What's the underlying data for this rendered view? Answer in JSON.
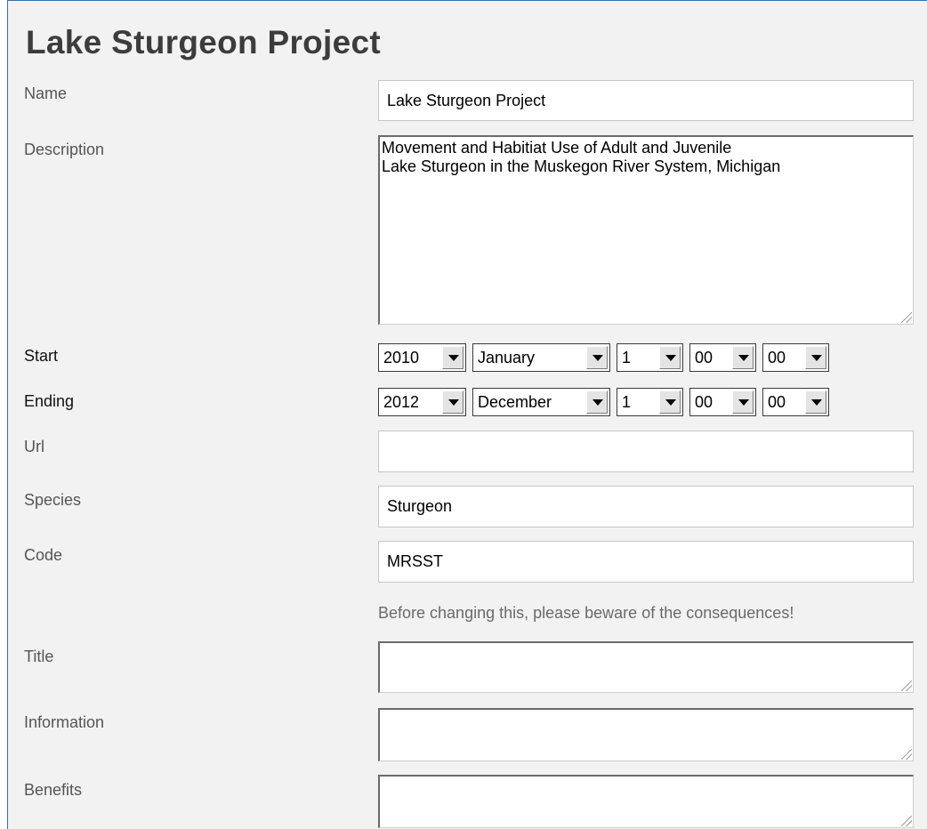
{
  "form": {
    "title": "Lake Sturgeon Project",
    "name": {
      "label": "Name",
      "value": "Lake Sturgeon Project"
    },
    "description": {
      "label": "Description",
      "value": "Movement and Habitiat Use of Adult and Juvenile\nLake Sturgeon in the Muskegon River System, Michigan"
    },
    "start": {
      "label": "Start",
      "year": "2010",
      "month": "January",
      "day": "1",
      "hour": "00",
      "minute": "00"
    },
    "ending": {
      "label": "Ending",
      "year": "2012",
      "month": "December",
      "day": "1",
      "hour": "00",
      "minute": "00"
    },
    "url": {
      "label": "Url",
      "value": ""
    },
    "species": {
      "label": "Species",
      "value": "Sturgeon"
    },
    "code": {
      "label": "Code",
      "value": "MRSST",
      "hint": "Before changing this, please beware of the consequences!"
    },
    "title_field": {
      "label": "Title",
      "value": ""
    },
    "information": {
      "label": "Information",
      "value": ""
    },
    "benefits": {
      "label": "Benefits",
      "value": ""
    }
  },
  "icons": {
    "dropdown": "chevron-down-icon",
    "resize": "resize-grip-icon"
  },
  "colors": {
    "panel_border": "#3d6fa8",
    "panel_bg": "#f2f2f2",
    "heading": "#3c3c3c"
  }
}
